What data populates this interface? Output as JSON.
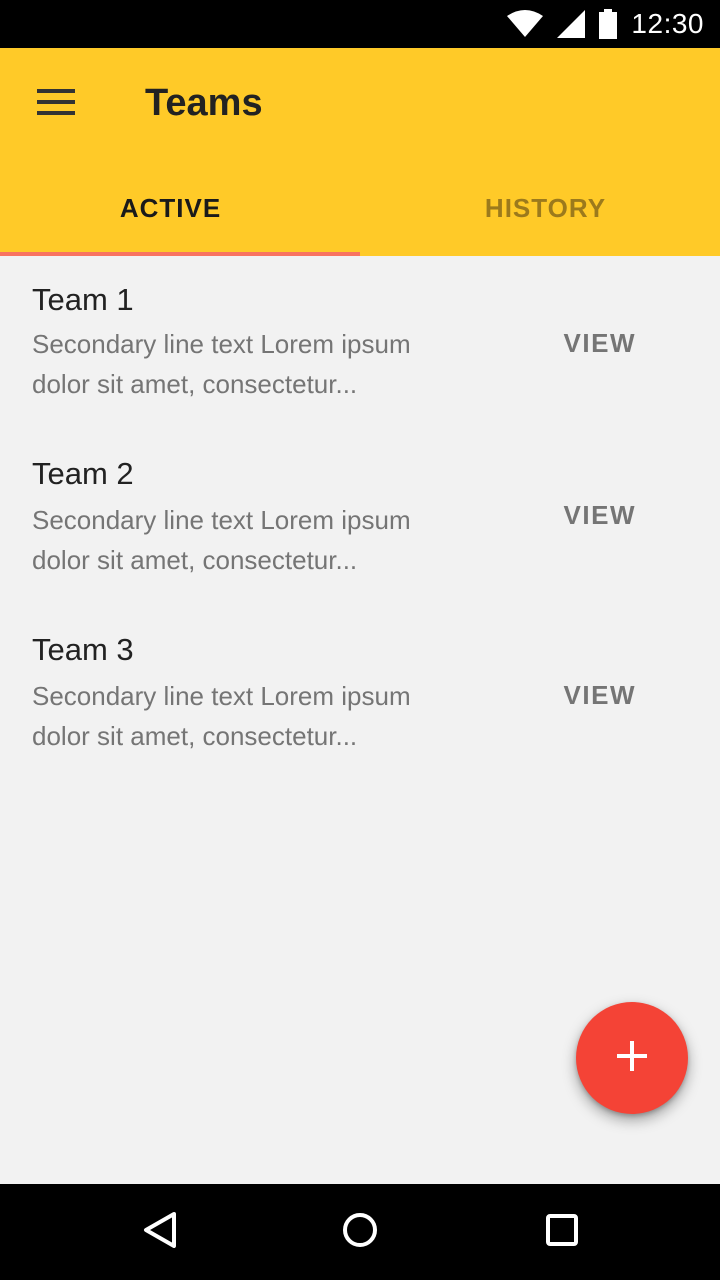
{
  "status_bar": {
    "time": "12:30",
    "icons": [
      "wifi-icon",
      "signal-icon",
      "battery-icon"
    ]
  },
  "app_bar": {
    "title": "Teams",
    "menu_icon": "menu-icon",
    "background": "#ffca28"
  },
  "tabs": [
    {
      "label": "ACTIVE",
      "selected": true
    },
    {
      "label": "HISTORY",
      "selected": false
    }
  ],
  "list": {
    "items": [
      {
        "title": "Team 1",
        "secondary": "Secondary line text Lorem ipsum dolor sit amet, consectetur...",
        "action": "VIEW"
      },
      {
        "title": "Team 2",
        "secondary": "Secondary line text Lorem ipsum dolor sit amet, consectetur...",
        "action": "VIEW"
      },
      {
        "title": "Team 3",
        "secondary": "Secondary line text Lorem ipsum dolor sit amet, consectetur...",
        "action": "VIEW"
      }
    ]
  },
  "fab": {
    "icon": "plus-icon",
    "color": "#f44336"
  },
  "nav_bar": {
    "icons": [
      "back-icon",
      "home-icon",
      "recents-icon"
    ]
  },
  "colors": {
    "accent": "#ffca28",
    "tab_indicator": "#f87360",
    "fab": "#f44336"
  }
}
